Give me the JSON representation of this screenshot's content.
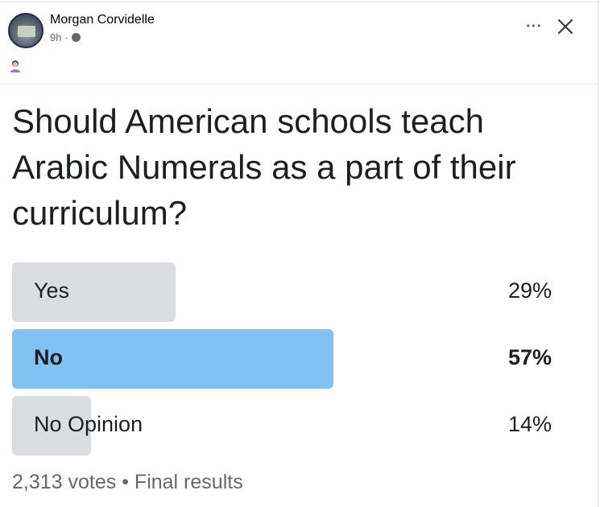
{
  "post": {
    "author": "Morgan Corvidelle",
    "time": "9h",
    "time_separator": " · ",
    "icons": {
      "privacy": "globe-icon",
      "emoji": "person-emoji-icon",
      "more": "more-options-icon",
      "close": "close-icon"
    },
    "more_label": "···"
  },
  "poll": {
    "question": "Should American schools teach Arabic Numerals as a part of their curriculum?",
    "options": [
      {
        "label": "Yes",
        "percent_text": "29%",
        "percent": 29,
        "selected": false
      },
      {
        "label": "No",
        "percent_text": "57%",
        "percent": 57,
        "selected": true
      },
      {
        "label": "No Opinion",
        "percent_text": "14%",
        "percent": 14,
        "selected": false
      }
    ],
    "votes": "2,313 votes",
    "footer_separator": " • ",
    "status": "Final results"
  },
  "colors": {
    "bar_default": "#dadde1",
    "bar_selected": "#82c2f3",
    "secondary_text": "#65676b"
  }
}
